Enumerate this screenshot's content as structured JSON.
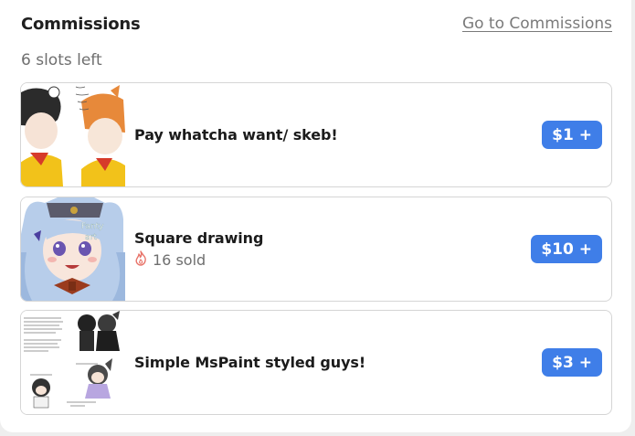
{
  "header": {
    "title": "Commissions",
    "link_label": "Go to Commissions",
    "slots_text": "6 slots left"
  },
  "colors": {
    "accent": "#3f7ee8",
    "fire": "#e8746a"
  },
  "commissions": [
    {
      "name": "Pay whatcha want/ skeb!",
      "price": "$1 +",
      "sold": null
    },
    {
      "name": "Square drawing",
      "price": "$10 +",
      "sold": "16 sold",
      "sold_icon": "fire-icon"
    },
    {
      "name": "Simple MsPaint styled guys!",
      "price": "$3 +",
      "sold": null
    }
  ]
}
